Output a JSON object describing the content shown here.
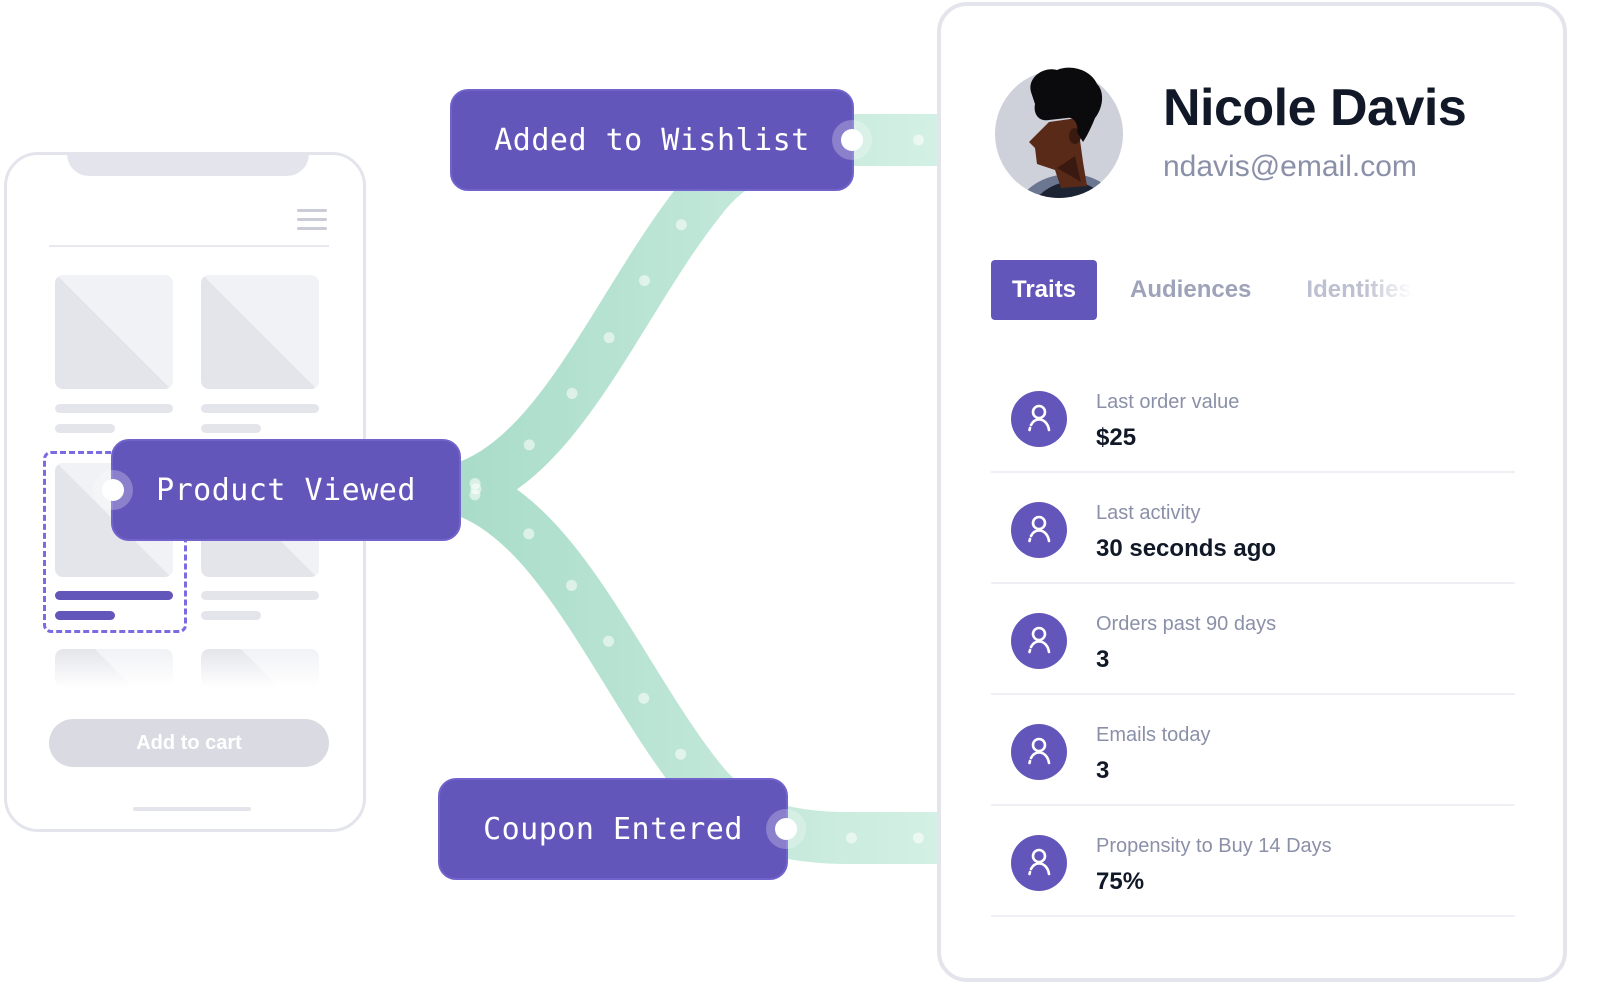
{
  "phone": {
    "add_to_cart_label": "Add to cart"
  },
  "events": [
    {
      "label": "Added to Wishlist"
    },
    {
      "label": "Product Viewed"
    },
    {
      "label": "Coupon Entered"
    }
  ],
  "profile": {
    "name": "Nicole Davis",
    "email": "ndavis@email.com",
    "avatar_icon": "person-portrait",
    "tabs": [
      {
        "label": "Traits",
        "active": true
      },
      {
        "label": "Audiences",
        "active": false
      },
      {
        "label": "Identities",
        "active": false
      }
    ],
    "traits": [
      {
        "label": "Last order value",
        "value": "$25",
        "icon": "user-icon"
      },
      {
        "label": "Last activity",
        "value": "30 seconds ago",
        "icon": "user-icon"
      },
      {
        "label": "Orders past 90 days",
        "value": "3",
        "icon": "user-icon"
      },
      {
        "label": "Emails today",
        "value": "3",
        "icon": "user-icon"
      },
      {
        "label": "Propensity to Buy 14 Days",
        "value": "75%",
        "icon": "user-icon"
      }
    ]
  },
  "colors": {
    "accent": "#6356bb",
    "stream": "#b9e6d6",
    "muted_text": "#8a90a8",
    "dark_text": "#111827"
  }
}
